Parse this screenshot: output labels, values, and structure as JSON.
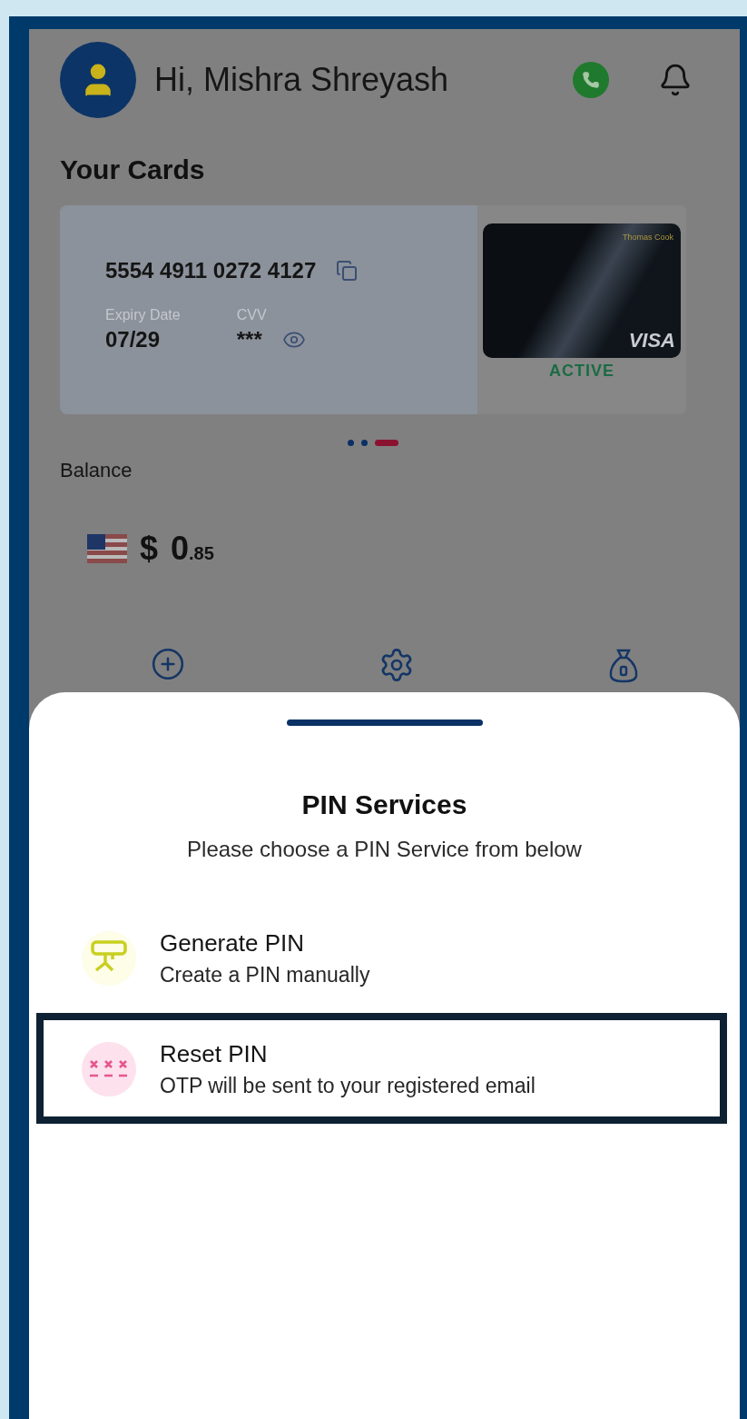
{
  "header": {
    "greeting": "Hi, Mishra Shreyash"
  },
  "cards_section": {
    "title": "Your Cards",
    "card": {
      "number": "5554 4911 0272 4127",
      "expiry_label": "Expiry Date",
      "expiry": "07/29",
      "cvv_label": "CVV",
      "cvv": "***",
      "status": "ACTIVE",
      "issuer": "Thomas Cook",
      "network": "VISA"
    },
    "pager": [
      {
        "selected": false
      },
      {
        "selected": false
      },
      {
        "selected": true
      }
    ]
  },
  "balance": {
    "label": "Balance",
    "currency": "$",
    "whole": "0",
    "fraction": ".85"
  },
  "actions": [
    {
      "kind": "add"
    },
    {
      "kind": "settings"
    },
    {
      "kind": "money"
    }
  ],
  "sheet": {
    "title": "PIN Services",
    "subtitle": "Please choose a PIN Service from below",
    "options": [
      {
        "kind": "generate",
        "title": "Generate PIN",
        "description": "Create a PIN manually",
        "selected": false
      },
      {
        "kind": "reset",
        "title": "Reset PIN",
        "description": "OTP will be sent to your registered email",
        "selected": true
      }
    ]
  }
}
